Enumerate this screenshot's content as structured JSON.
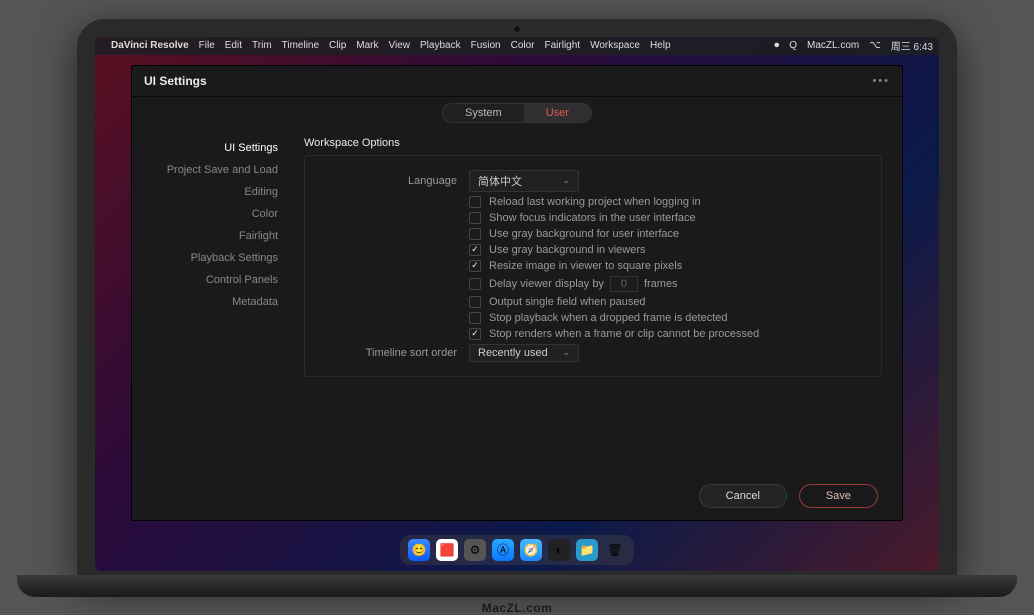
{
  "menubar": {
    "app": "DaVinci Resolve",
    "items": [
      "File",
      "Edit",
      "Trim",
      "Timeline",
      "Clip",
      "Mark",
      "View",
      "Playback",
      "Fusion",
      "Color",
      "Fairlight",
      "Workspace",
      "Help"
    ],
    "right_site": "MacZL.com",
    "right_time": "周三 6:43"
  },
  "dialog": {
    "title": "UI Settings",
    "tabs": {
      "system": "System",
      "user": "User"
    },
    "sidebar": [
      "UI Settings",
      "Project Save and Load",
      "Editing",
      "Color",
      "Fairlight",
      "Playback Settings",
      "Control Panels",
      "Metadata"
    ],
    "section": "Workspace Options",
    "language_label": "Language",
    "language_value": "简体中文",
    "checks": {
      "reload": {
        "label": "Reload last working project when logging in",
        "checked": false
      },
      "focus": {
        "label": "Show focus indicators in the user interface",
        "checked": false
      },
      "graybg_ui": {
        "label": "Use gray background for user interface",
        "checked": false
      },
      "graybg_viewer": {
        "label": "Use gray background in viewers",
        "checked": true
      },
      "resize_square": {
        "label": "Resize image in viewer to square pixels",
        "checked": true
      },
      "delay_viewer": {
        "label": "Delay viewer display by",
        "value": "0",
        "unit": "frames",
        "checked": false
      },
      "output_single": {
        "label": "Output single field when paused",
        "checked": false
      },
      "stop_drop": {
        "label": "Stop playback when a dropped frame is detected",
        "checked": false
      },
      "stop_render": {
        "label": "Stop renders when a frame or clip cannot be processed",
        "checked": true
      }
    },
    "sort_label": "Timeline sort order",
    "sort_value": "Recently used",
    "cancel": "Cancel",
    "save": "Save"
  },
  "watermark": "MacZL.com"
}
